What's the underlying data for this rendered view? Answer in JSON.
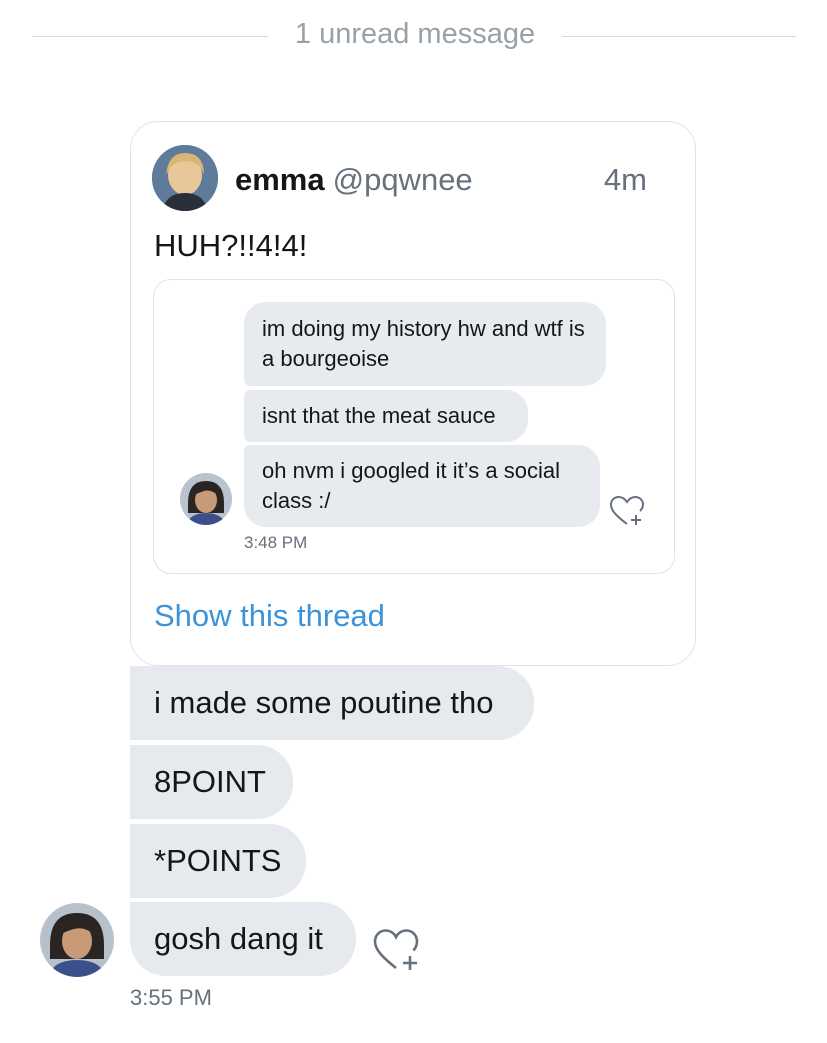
{
  "divider": {
    "label": "1 unread message"
  },
  "shared_tweet": {
    "display_name": "emma",
    "screen_name": "@pqwnee",
    "time_ago": "4m",
    "text": "HUH?!!4!4!",
    "embedded_messages": [
      {
        "text": "im doing my history hw and wtf is a bourgeoise"
      },
      {
        "text": "isnt that the meat sauce"
      },
      {
        "text": "oh nvm i googled it it’s a social class :/"
      }
    ],
    "embedded_time": "3:48 PM",
    "show_thread_label": "Show this thread"
  },
  "messages": [
    {
      "text": "i made some poutine tho"
    },
    {
      "text": "8POINT"
    },
    {
      "text": "*POINTS"
    },
    {
      "text": "gosh dang it"
    }
  ],
  "timestamp": "3:55 PM",
  "icons": {
    "like": "heart-plus-icon",
    "avatar": "user-avatar"
  },
  "colors": {
    "link": "#3b94d9",
    "bubble": "#e6e9ed",
    "muted": "#66717d"
  }
}
